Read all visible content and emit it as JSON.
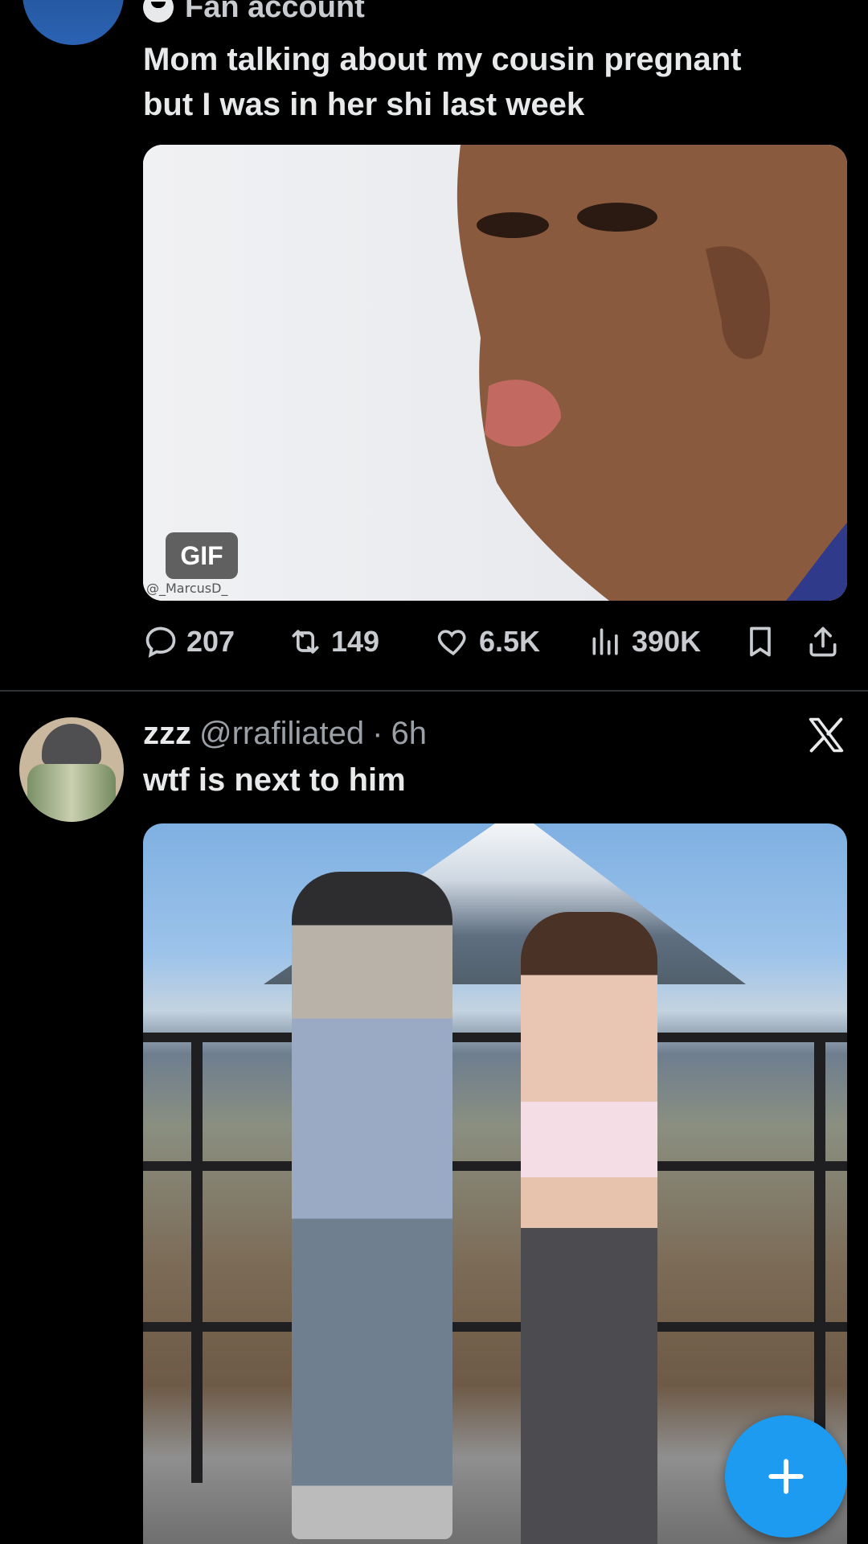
{
  "tweet1": {
    "author_label": "Fan account",
    "text_line1": "Mom talking about my cousin pregnant",
    "text_line2": "but I was in her shi last week",
    "media_badge": "GIF",
    "media_watermark": "@_MarcusD_",
    "actions": {
      "replies": "207",
      "reposts": "149",
      "likes": "6.5K",
      "views": "390K"
    }
  },
  "tweet2": {
    "name": "zzz",
    "handle": "@rrafiliated",
    "separator": "·",
    "time": "6h",
    "text": "wtf is next to him"
  },
  "colors": {
    "background": "#000000",
    "text": "#e7e9ea",
    "muted": "#9aa0a6",
    "accent": "#1d9bf0",
    "divider": "#2f3336"
  },
  "icons": {
    "reply": "reply-icon",
    "repost": "repost-icon",
    "like": "heart-icon",
    "views": "views-icon",
    "bookmark": "bookmark-icon",
    "share": "share-icon",
    "x_logo": "x-logo-icon",
    "compose": "plus-icon"
  }
}
